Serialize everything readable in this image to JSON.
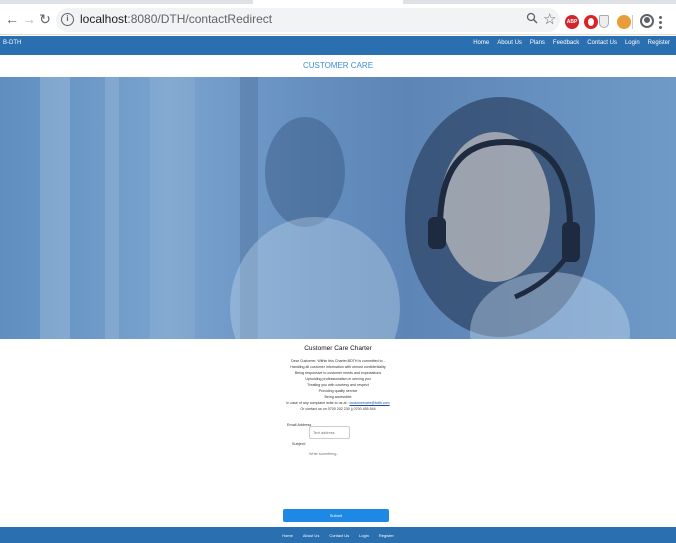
{
  "browser": {
    "url_host": "localhost",
    "url_rest": ":8080/DTH/contactRedirect",
    "extensions": [
      "abp-icon",
      "opera-icon",
      "shield-icon",
      "cookie-icon"
    ],
    "abp_label": "ABP"
  },
  "navbar": {
    "brand": "B-DTH",
    "links": [
      "Home",
      "About Us",
      "Plans",
      "Feedback",
      "Contact Us",
      "Login",
      "Register"
    ]
  },
  "page": {
    "heading": "CUSTOMER CARE"
  },
  "charter": {
    "title": "Customer Care Charter",
    "lines": [
      "Dear Customer, Within this Charter,BDTH is committed to -",
      "Handling all customer information with utmost confidentiality",
      "Being responsive to customer needs and expectations",
      "Upholding professionalism in serving you",
      "Treating you with courtesy and respect",
      "Providing quality service",
      "Being accessible"
    ],
    "complaint_prefix": "In case of any complaint write to us at :",
    "complaint_email": "customercare@bdth.com",
    "contact_line": "Or contact us on 0700 202 230 || 0700 455 544"
  },
  "form": {
    "email_label": "Email Address",
    "email_placeholder": "Text address",
    "subject_label": "Subject:",
    "subject_placeholder": "Write something..",
    "submit_label": "Submit"
  },
  "footer": {
    "links": [
      "Home",
      "About Us",
      "Contact Us",
      "Login",
      "Register"
    ]
  },
  "colors": {
    "navbar": "#2a6fb0",
    "heading": "#3c8fd6",
    "submit": "#1e88e5"
  }
}
